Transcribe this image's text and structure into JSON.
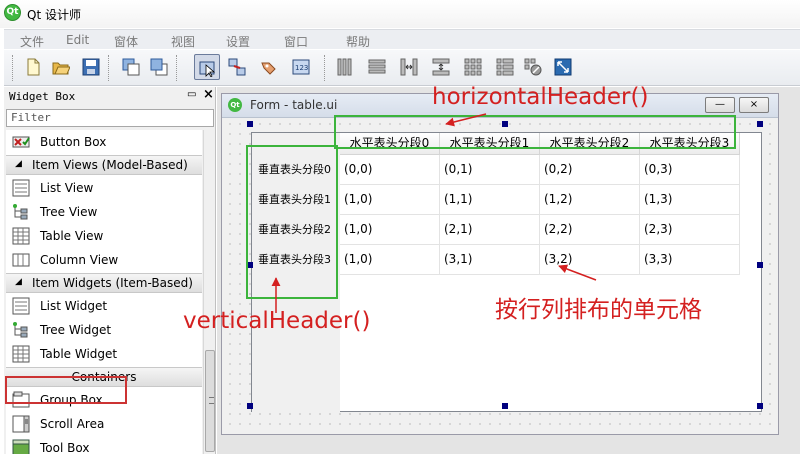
{
  "app": {
    "title": "Qt 设计师",
    "logo": "Qt"
  },
  "menu": [
    "文件",
    "Edit",
    "窗体",
    "视图",
    "设置",
    "窗口",
    "帮助"
  ],
  "toolbar_icons": [
    "new-file-icon",
    "open-file-icon",
    "save-file-icon",
    "send-to-back-icon",
    "bring-to-front-icon",
    "edit-widgets-icon",
    "edit-signals-slots-icon",
    "edit-buddies-icon",
    "edit-tab-order-icon",
    "layout-horizontal-icon",
    "layout-vertical-icon",
    "layout-horizontal-splitter-icon",
    "layout-vertical-splitter-icon",
    "layout-grid-icon",
    "layout-form-icon",
    "break-layout-icon",
    "adjust-size-icon"
  ],
  "widget_box": {
    "title": "Widget Box",
    "float_icon": "float-icon",
    "close_icon": "close-icon",
    "filter_placeholder": "Filter",
    "entries": [
      {
        "type": "item",
        "icon": "button-box-icon",
        "label": "Button Box"
      },
      {
        "type": "category",
        "label": "Item Views (Model-Based)"
      },
      {
        "type": "item",
        "icon": "list-view-icon",
        "label": "List View"
      },
      {
        "type": "item",
        "icon": "tree-view-icon",
        "label": "Tree View"
      },
      {
        "type": "item",
        "icon": "table-view-icon",
        "label": "Table View"
      },
      {
        "type": "item",
        "icon": "column-view-icon",
        "label": "Column View"
      },
      {
        "type": "category",
        "label": "Item Widgets (Item-Based)"
      },
      {
        "type": "item",
        "icon": "list-widget-icon",
        "label": "List Widget"
      },
      {
        "type": "item",
        "icon": "tree-widget-icon",
        "label": "Tree Widget"
      },
      {
        "type": "item",
        "icon": "table-widget-icon",
        "label": "Table Widget"
      },
      {
        "type": "category",
        "label": "Containers",
        "centered": true
      },
      {
        "type": "item",
        "icon": "group-box-icon",
        "label": "Group Box"
      },
      {
        "type": "item",
        "icon": "scroll-area-icon",
        "label": "Scroll Area"
      },
      {
        "type": "item",
        "icon": "tool-box-icon",
        "label": "Tool Box"
      }
    ],
    "highlighted": "Table Widget"
  },
  "form_window": {
    "title": "Form - table.ui",
    "minimize_icon": "minimize-icon",
    "close_icon": "close-icon"
  },
  "table": {
    "horizontal_headers": [
      "水平表头分段0",
      "水平表头分段1",
      "水平表头分段2",
      "水平表头分段3"
    ],
    "vertical_headers": [
      "垂直表头分段0",
      "垂直表头分段1",
      "垂直表头分段2",
      "垂直表头分段3"
    ],
    "cells": [
      [
        "(0,0)",
        "(0,1)",
        "(0,2)",
        "(0,3)"
      ],
      [
        "(1,0)",
        "(1,1)",
        "(1,2)",
        "(1,3)"
      ],
      [
        "(1,0)",
        "(2,1)",
        "(2,2)",
        "(2,3)"
      ],
      [
        "(1,0)",
        "(3,1)",
        "(3,2)",
        "(3,3)"
      ]
    ]
  },
  "annotations": {
    "horizontal": "horizontalHeader()",
    "vertical": "verticalHeader()",
    "cells": "按行列排布的单元格",
    "color": "#d42020",
    "box_color": "#3cb43c"
  }
}
